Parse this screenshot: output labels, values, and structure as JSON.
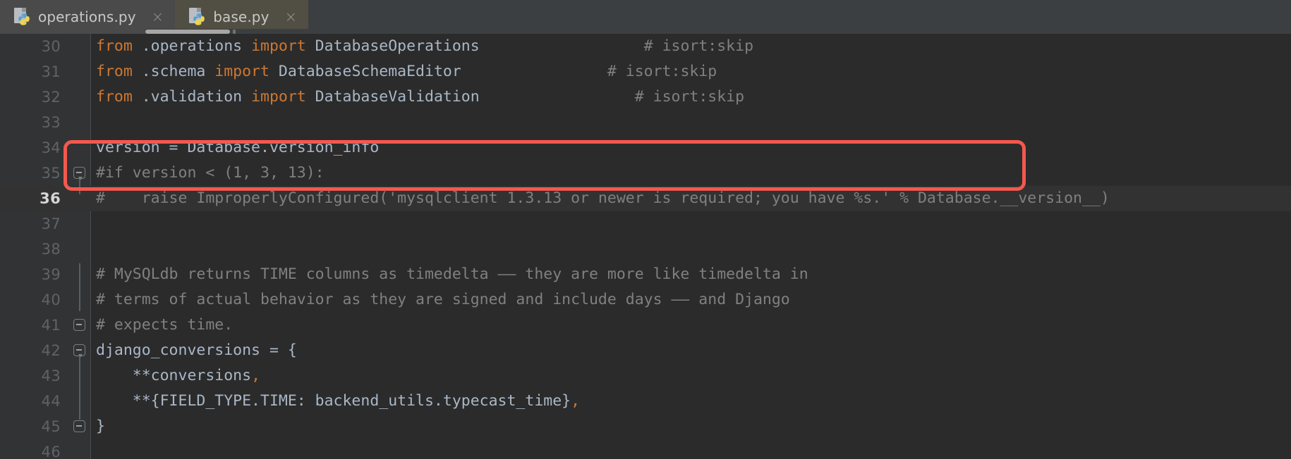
{
  "window": {
    "app": "pycharm-editor",
    "theme": "darcula"
  },
  "colors": {
    "editor_bg": "#2b2b2b",
    "gutter_bg": "#313335",
    "tabbar_bg": "#3c3f41",
    "tab_active_bg": "#514e43",
    "tab_inactive_bg": "#4a4a4a",
    "keyword": "#cc7832",
    "comment": "#808080",
    "identifier": "#a9b7c6",
    "line_number": "#606366",
    "current_line_bg": "#323232",
    "annotation_red": "#f4584e",
    "scrollbar_thumb": "#a6a6a6"
  },
  "tabs": [
    {
      "label": "operations.py",
      "icon": "python-file-icon",
      "close_icon": "×",
      "active": false
    },
    {
      "label": "base.py",
      "icon": "python-file-icon",
      "close_icon": "×",
      "active": true
    }
  ],
  "editor": {
    "current_line": 36,
    "first_visible_line": 30,
    "last_visible_line": 46,
    "lines": [
      {
        "number": "30",
        "fold": null,
        "tokens": [
          {
            "t": "from",
            "c": "kw"
          },
          {
            "t": " .operations ",
            "c": "id"
          },
          {
            "t": "import",
            "c": "kw"
          },
          {
            "t": " DatabaseOperations",
            "c": "id"
          },
          {
            "t": "                  # isort:skip",
            "c": "cmt"
          }
        ]
      },
      {
        "number": "31",
        "fold": null,
        "tokens": [
          {
            "t": "from",
            "c": "kw"
          },
          {
            "t": " .schema ",
            "c": "id"
          },
          {
            "t": "import",
            "c": "kw"
          },
          {
            "t": " DatabaseSchemaEditor",
            "c": "id"
          },
          {
            "t": "                # isort:skip",
            "c": "cmt"
          }
        ]
      },
      {
        "number": "32",
        "fold": null,
        "tokens": [
          {
            "t": "from",
            "c": "kw"
          },
          {
            "t": " .validation ",
            "c": "id"
          },
          {
            "t": "import",
            "c": "kw"
          },
          {
            "t": " DatabaseValidation",
            "c": "id"
          },
          {
            "t": "                 # isort:skip",
            "c": "cmt"
          }
        ]
      },
      {
        "number": "33",
        "fold": null,
        "tokens": []
      },
      {
        "number": "34",
        "fold": null,
        "tokens": [
          {
            "t": "version = Database.version_info",
            "c": "id"
          }
        ]
      },
      {
        "number": "35",
        "fold": "down",
        "tokens": [
          {
            "t": "#if version < (1, 3, 13):",
            "c": "cmt"
          }
        ]
      },
      {
        "number": "36",
        "fold": null,
        "tokens": [
          {
            "t": "#    raise ImproperlyConfigured('mysqlclient 1.3.13 or newer is required; you have %s.' % Database.__version__)",
            "c": "cmt"
          }
        ]
      },
      {
        "number": "37",
        "fold": null,
        "tokens": []
      },
      {
        "number": "38",
        "fold": null,
        "tokens": []
      },
      {
        "number": "39",
        "fold": null,
        "tokens": [
          {
            "t": "# MySQLdb returns TIME columns as timedelta —— they are more like timedelta in",
            "c": "cmt"
          }
        ]
      },
      {
        "number": "40",
        "fold": null,
        "tokens": [
          {
            "t": "# terms of actual behavior as they are signed and include days —— and Django",
            "c": "cmt"
          }
        ]
      },
      {
        "number": "41",
        "fold": "up",
        "tokens": [
          {
            "t": "# expects time.",
            "c": "cmt"
          }
        ]
      },
      {
        "number": "42",
        "fold": "down",
        "tokens": [
          {
            "t": "django_conversions = {",
            "c": "id"
          }
        ]
      },
      {
        "number": "43",
        "fold": null,
        "tokens": [
          {
            "t": "    **conversions",
            "c": "id"
          },
          {
            "t": ",",
            "c": "punc"
          }
        ]
      },
      {
        "number": "44",
        "fold": null,
        "tokens": [
          {
            "t": "    **{FIELD_TYPE.TIME: backend_utils.typecast_time}",
            "c": "id"
          },
          {
            "t": ",",
            "c": "punc"
          }
        ]
      },
      {
        "number": "45",
        "fold": "up",
        "tokens": [
          {
            "t": "}",
            "c": "id"
          }
        ]
      },
      {
        "number": "46",
        "fold": null,
        "tokens": []
      }
    ]
  },
  "annotation": {
    "type": "highlight-rectangle",
    "color": "#f4584e",
    "covers_lines": "35-36",
    "label": "red-highlight-box"
  },
  "scrollbar": {
    "orientation": "horizontal",
    "name": "editor-horizontal-scrollbar"
  }
}
